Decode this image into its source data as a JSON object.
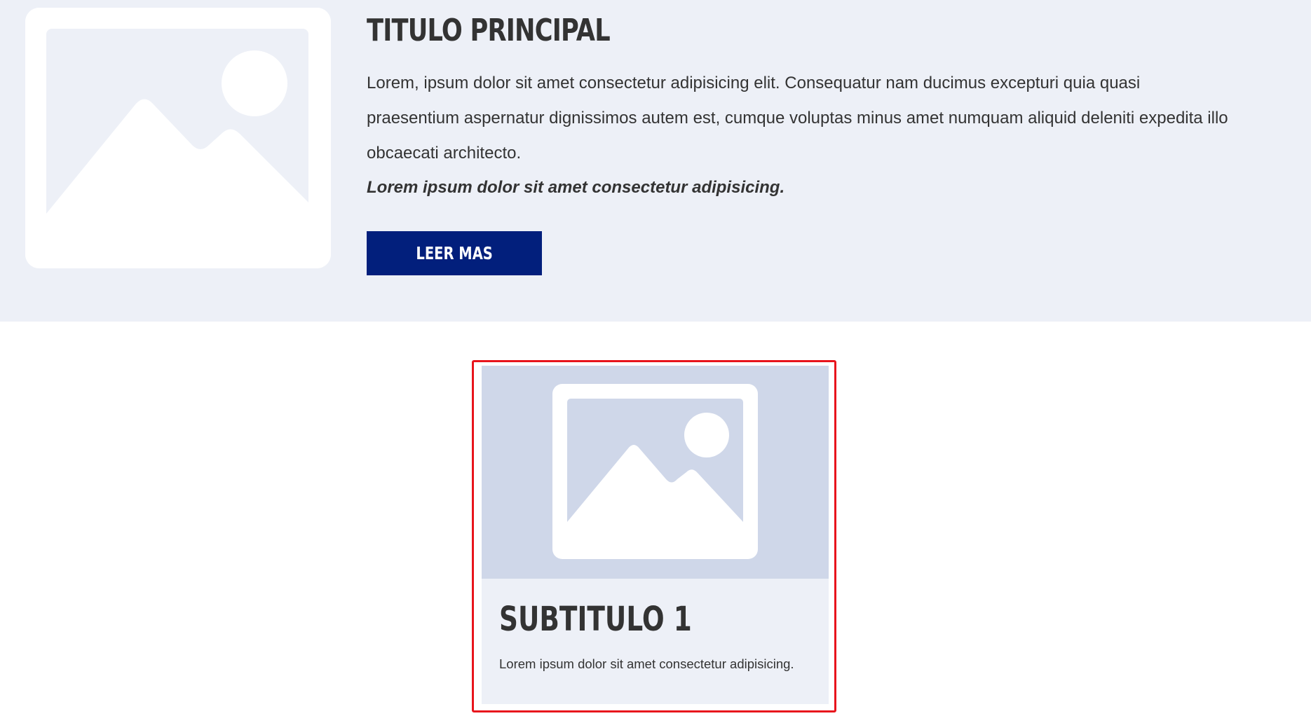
{
  "colors": {
    "hero_background": "#edf0f7",
    "button_background": "#021f7c",
    "button_text": "#ffffff",
    "card_image_background": "#cfd7e9",
    "card_background": "#edf0f7",
    "highlight_border": "#e8141c",
    "text": "#333333"
  },
  "hero": {
    "image_icon": "image-placeholder-icon",
    "title": "TITULO PRINCIPAL",
    "body": "Lorem, ipsum dolor sit amet consectetur adipisicing elit. Consequatur nam ducimus excepturi quia quasi praesentium aspernatur dignissimos autem est, cumque voluptas minus amet numquam aliquid deleniti expedita illo obcaecati architecto.",
    "emphasis": "Lorem ipsum dolor sit amet consectetur adipisicing.",
    "button_label": "LEER MAS"
  },
  "card": {
    "image_icon": "image-placeholder-icon",
    "title": "SUBTITULO 1",
    "text": "Lorem ipsum dolor sit amet consectetur adipisicing."
  }
}
